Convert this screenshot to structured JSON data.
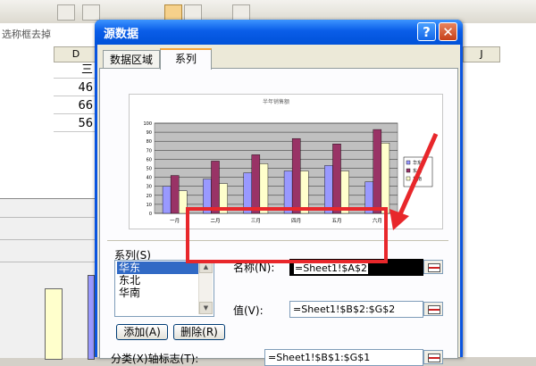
{
  "spreadsheet": {
    "column_headers": [
      "D",
      "J"
    ],
    "cells": [
      "三",
      "46",
      "66",
      "56"
    ],
    "formula_bar_text": "选称框去掉"
  },
  "dialog": {
    "title": "源数据",
    "help_label": "?",
    "close_label": "✕",
    "tabs": [
      {
        "label": "数据区域",
        "selected": false
      },
      {
        "label": "系列",
        "selected": true
      }
    ],
    "series_section_label": "系列(S)",
    "series_list": [
      "华东",
      "东北",
      "华南"
    ],
    "selected_series": "华东",
    "add_button": "添加(A)",
    "delete_button": "删除(R)",
    "name_label": "名称(N):",
    "name_value": "=Sheet1!$A$2",
    "values_label": "值(V):",
    "values_value": "=Sheet1!$B$2:$G$2",
    "category_label": "分类(X)轴标志(T):",
    "category_value": "=Sheet1!$B$1:$G$1"
  },
  "chart_data": {
    "type": "bar",
    "title": "半年销售额",
    "categories": [
      "一月",
      "二月",
      "三月",
      "四月",
      "五月",
      "六月"
    ],
    "series": [
      {
        "name": "华东",
        "values": [
          30,
          38,
          45,
          47,
          53,
          35
        ],
        "color": "#9999ff"
      },
      {
        "name": "东北",
        "values": [
          42,
          58,
          65,
          83,
          77,
          93
        ],
        "color": "#993366"
      },
      {
        "name": "华南",
        "values": [
          25,
          33,
          55,
          47,
          47,
          78
        ],
        "color": "#ffffcc"
      }
    ],
    "ylim": [
      0,
      100
    ],
    "yticks": [
      0,
      10,
      20,
      30,
      40,
      50,
      60,
      70,
      80,
      90,
      100
    ],
    "plot_background": "#c0c0c0",
    "grid": true,
    "legend": "right"
  }
}
